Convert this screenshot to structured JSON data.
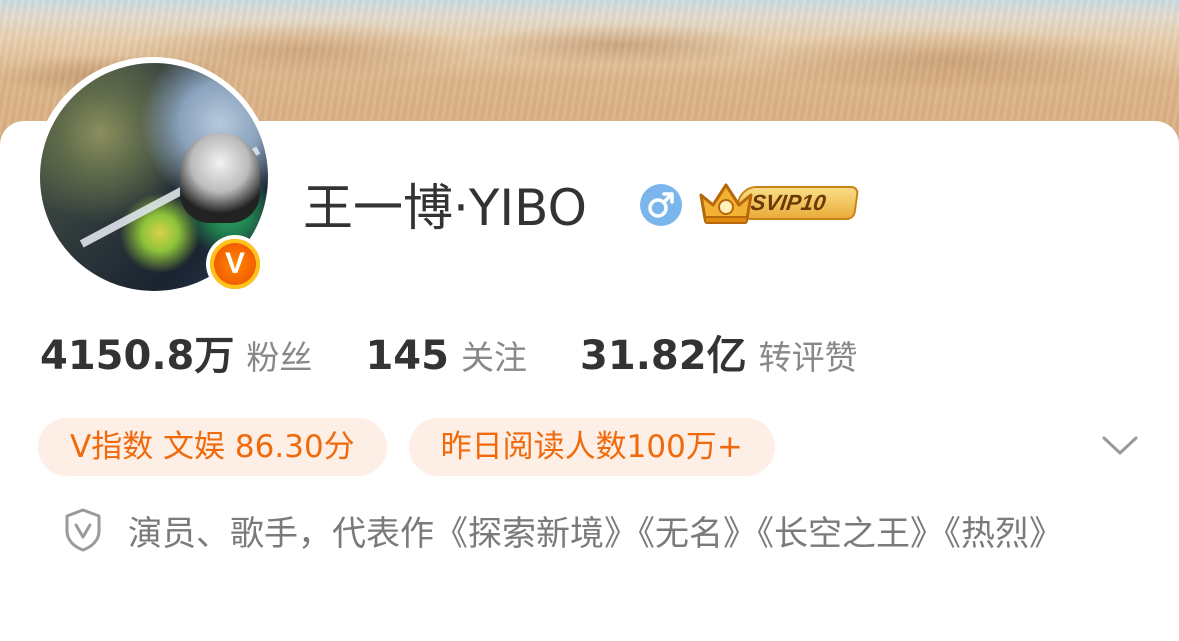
{
  "profile": {
    "name": "王一博·YIBO",
    "verified_badge": "V",
    "gender_icon": "male-icon",
    "vip_badge": "SVIP10"
  },
  "stats": [
    {
      "value": "4150.8万",
      "label": "粉丝"
    },
    {
      "value": "145",
      "label": "关注"
    },
    {
      "value": "31.82亿",
      "label": "转评赞"
    }
  ],
  "tags": [
    {
      "text": "V指数 文娱 86.30分"
    },
    {
      "text": "昨日阅读人数100万+"
    }
  ],
  "bio": {
    "icon": "shield-v-icon",
    "text": "演员、歌手，代表作《探索新境》《无名》《长空之王》《热烈》"
  },
  "colors": {
    "accent_orange": "#f06a0c",
    "tag_bg": "#fdeee6",
    "gender_blue": "#7ab6ec",
    "text_dark": "#333333",
    "text_gray": "#888888"
  }
}
